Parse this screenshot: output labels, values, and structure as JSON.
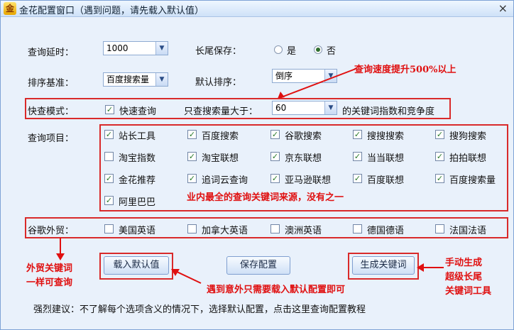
{
  "window": {
    "title": "金花配置窗口（遇到问题，请先载入默认值）",
    "icon": "gold-flower-logo-icon"
  },
  "settings": {
    "delay_label": "查询延时：",
    "delay_value": "1000",
    "tail_label": "长尾保存：",
    "tail_yes": "是",
    "tail_no": "否",
    "sort_base_label": "排序基准：",
    "sort_base_value": "百度搜索量",
    "default_sort_label": "默认排序：",
    "default_sort_value": "倒序",
    "quick_mode_label": "快查模式：",
    "quick_query_label": "快速查询",
    "volume_label": "只查搜索量大于：",
    "volume_value": "60",
    "volume_suffix": "的关键词指数和竞争度"
  },
  "query_items": {
    "label": "查询项目：",
    "items": [
      {
        "label": "站长工具",
        "checked": true
      },
      {
        "label": "百度搜索",
        "checked": true
      },
      {
        "label": "谷歌搜索",
        "checked": true
      },
      {
        "label": "搜搜搜索",
        "checked": true
      },
      {
        "label": "搜狗搜索",
        "checked": true
      },
      {
        "label": "淘宝指数",
        "checked": false
      },
      {
        "label": "淘宝联想",
        "checked": true
      },
      {
        "label": "京东联想",
        "checked": true
      },
      {
        "label": "当当联想",
        "checked": true
      },
      {
        "label": "拍拍联想",
        "checked": true
      },
      {
        "label": "金花推荐",
        "checked": true
      },
      {
        "label": "追词云查询",
        "checked": true
      },
      {
        "label": "亚马逊联想",
        "checked": true
      },
      {
        "label": "百度联想",
        "checked": true
      },
      {
        "label": "百度搜索量",
        "checked": true
      },
      {
        "label": "阿里巴巴",
        "checked": true
      }
    ]
  },
  "foreign": {
    "label": "谷歌外贸：",
    "items": [
      {
        "label": "美国英语",
        "checked": false
      },
      {
        "label": "加拿大英语",
        "checked": false
      },
      {
        "label": "澳洲英语",
        "checked": false
      },
      {
        "label": "德国德语",
        "checked": false
      },
      {
        "label": "法国法语",
        "checked": false
      }
    ]
  },
  "buttons": {
    "load_default": "载入默认值",
    "save_config": "保存配置",
    "generate": "生成关键词"
  },
  "footer": {
    "advice": "强烈建议：不了解每个选项含义的情况下，选择默认配置，点击这里查询配置教程"
  },
  "annotations": {
    "speed": "查询速度提升500%以上",
    "source": "业内最全的查询关键词来源，没有之一",
    "foreign_line1": "外贸关键词",
    "foreign_line2": "一样可查询",
    "load_hint": "遇到意外只需要载入默认配置即可",
    "manual_line1": "手动生成",
    "manual_line2": "超级长尾",
    "manual_line3": "关键词工具"
  },
  "colors": {
    "annotation_red": "#e01010",
    "checkmark_green": "#2a7a2a"
  }
}
